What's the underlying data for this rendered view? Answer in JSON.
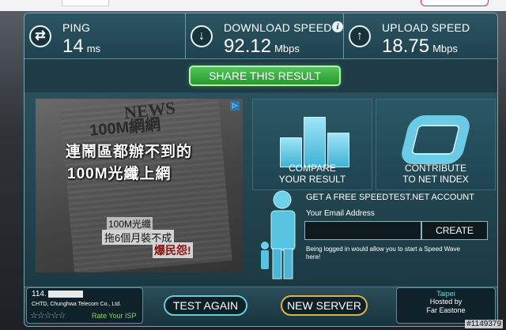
{
  "metrics": {
    "ping": {
      "label": "PING",
      "value": "14",
      "unit": "ms",
      "icon": "arrows-exchange-icon"
    },
    "download": {
      "label": "DOWNLOAD SPEED",
      "value": "92.12",
      "unit": "Mbps",
      "icon": "arrow-down-icon"
    },
    "upload": {
      "label": "UPLOAD SPEED",
      "value": "18.75",
      "unit": "Mbps",
      "icon": "arrow-up-icon"
    }
  },
  "share_label": "SHARE THIS RESULT",
  "ad": {
    "news": "NEWS",
    "headline_top": "100M網網",
    "line1": "連鬧區都辦不到的",
    "line2": "100M光纖上網",
    "sub1": "100M光纖",
    "sub2": "拖6個月裝不成",
    "sub3": "爆民怨!"
  },
  "compare": {
    "line1": "COMPARE",
    "line2": "YOUR RESULT"
  },
  "contribute": {
    "line1": "CONTRIBUTE",
    "line2": "TO NET INDEX"
  },
  "account": {
    "title": "GET A FREE SPEEDTEST.NET ACCOUNT",
    "email_label": "Your Email Address",
    "email_value": "",
    "create_label": "CREATE",
    "note": "Being logged in would allow you to start a Speed Wave here!"
  },
  "isp": {
    "ip_prefix": "114.",
    "name": "CHTD, Chunghwa Telecom Co., Ltd.",
    "stars": "☆☆☆☆☆",
    "rating": 0,
    "rate_label": "Rate Your ISP"
  },
  "buttons": {
    "test_again": "TEST AGAIN",
    "new_server": "NEW SERVER"
  },
  "server": {
    "city": "Taipei",
    "hosted_by": "Hosted by",
    "host": "Far Eastone"
  },
  "watermark": "#1149379",
  "colors": {
    "share_green": "#2fae38",
    "accent_cyan": "#67c9e2",
    "new_server_gold": "#d8b54a",
    "panel_teal": "#1f3b45"
  }
}
